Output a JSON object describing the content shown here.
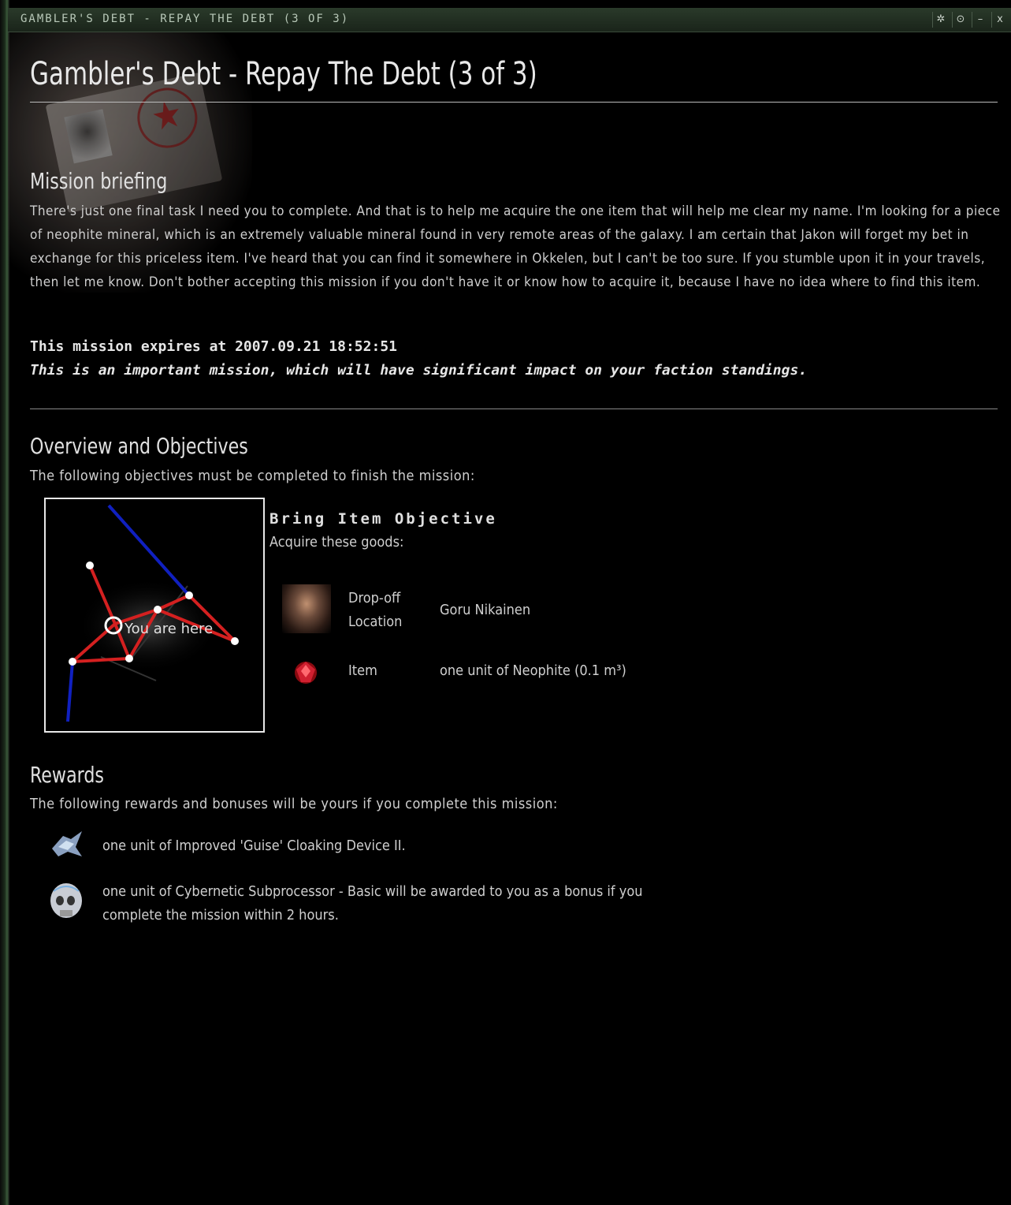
{
  "window": {
    "title": "GAMBLER'S DEBT - REPAY THE DEBT (3 OF 3)",
    "controls": [
      "options",
      "pin",
      "minimize",
      "close"
    ]
  },
  "page": {
    "title": "Gambler's Debt - Repay The Debt (3 of 3)"
  },
  "briefing": {
    "heading": "Mission briefing",
    "text": "There's just one final task I need you to complete. And that is to help me acquire the one item that will help me clear my name. I'm looking for a piece of neophite mineral, which is an extremely valuable mineral found in very remote areas of the galaxy. I am certain that Jakon will forget my bet in exchange for this priceless item. I've heard that you can find it somewhere in Okkelen, but I can't be too sure. If you stumble upon it in your travels, then let me know. Don't bother accepting this mission if you don't have it or know how to acquire it, because I have no idea where to find this item.",
    "expires": "This mission expires at 2007.09.21 18:52:51",
    "important": "This is an important mission, which will have significant impact on your faction standings."
  },
  "overview": {
    "heading": "Overview and Objectives",
    "intro": "The following objectives must be completed to finish the mission:",
    "map_label": "You are here",
    "objective_title": "Bring Item Objective",
    "objective_sub": "Acquire these goods:",
    "dropoff_label_1": "Drop-off",
    "dropoff_label_2": "Location",
    "dropoff_value": "Goru Nikainen",
    "item_label": "Item",
    "item_value": "one unit of Neophite (0.1 m³)"
  },
  "rewards": {
    "heading": "Rewards",
    "intro": "The following rewards and bonuses will be yours if you complete this mission:",
    "reward_1": "one unit of Improved 'Guise' Cloaking Device II.",
    "reward_2": "one unit of Cybernetic Subprocessor - Basic will be awarded to you as a bonus if you complete the mission within 2 hours."
  },
  "colors": {
    "route_red": "#d42020",
    "route_blue": "#1020c0",
    "background": "#000000",
    "titlebar": "#1f2b1f"
  },
  "icons": {
    "portrait": "agent-portrait-icon",
    "item": "neophite-gem-icon",
    "reward_1": "cloaking-device-icon",
    "reward_2": "skull-implant-icon"
  }
}
